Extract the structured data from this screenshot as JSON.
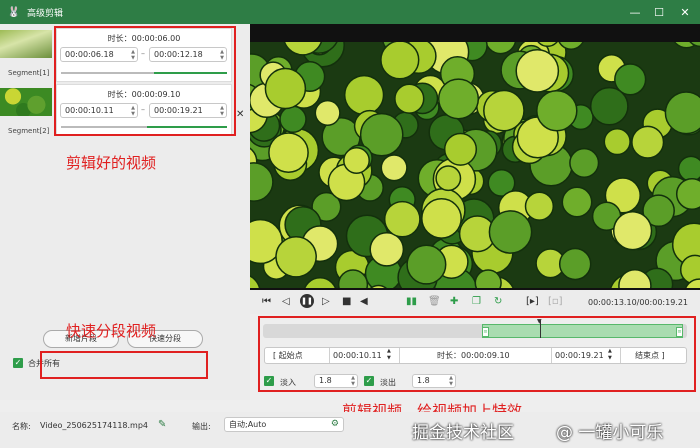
{
  "window": {
    "title": "高级剪辑",
    "app_icon": "🐰",
    "minimize": "—",
    "maximize": "☐",
    "close": "✕"
  },
  "segments": [
    {
      "label": "Segment[1]",
      "duration": "时长：00:00:06.00",
      "start": "00:00:06.18",
      "end": "00:00:12.18"
    },
    {
      "label": "Segment[2]",
      "duration": "时长：00:00:09.10",
      "start": "00:00:10.11",
      "end": "00:00:19.21"
    }
  ],
  "annotations": {
    "edited": "剪辑好的视频",
    "split": "快速分段视频",
    "effects": "剪辑视频，给视频加上特效"
  },
  "left_buttons": {
    "add_segment": "新增片段",
    "quick_split": "快速分段"
  },
  "merge_all": "合并所有",
  "player": {
    "time_readout": "00:00:13.10/00:00:19.21",
    "icons": [
      "skip-start-icon",
      "step-back-icon",
      "pause-icon",
      "step-forward-icon",
      "stop-icon",
      "volume-icon",
      "split-icon",
      "delete-icon",
      "add-icon",
      "copy-icon",
      "undo-icon",
      "mark-in-icon",
      "mark-out-icon"
    ],
    "timeline_progress": 0.66
  },
  "trim": {
    "start_label": "[ 起始点",
    "start_value": "00:00:10.11",
    "duration": "时长：00:00:09.10",
    "end_value": "00:00:19.21",
    "end_label": "结束点 ]"
  },
  "fade": {
    "in_label": "淡入",
    "in_value": "1.8",
    "out_label": "淡出",
    "out_value": "1.8"
  },
  "output": {
    "name_label": "名称:",
    "name_value": "Video_250625174118.mp4",
    "output_label": "输出:",
    "output_value": "自动;Auto"
  },
  "watermark": {
    "text1": "掘金技术社区",
    "text2": "@ 一罐小可乐"
  },
  "colors": {
    "titlebar": "#2e7d45",
    "accent": "#2e9d4a",
    "annotation": "#e02020"
  }
}
